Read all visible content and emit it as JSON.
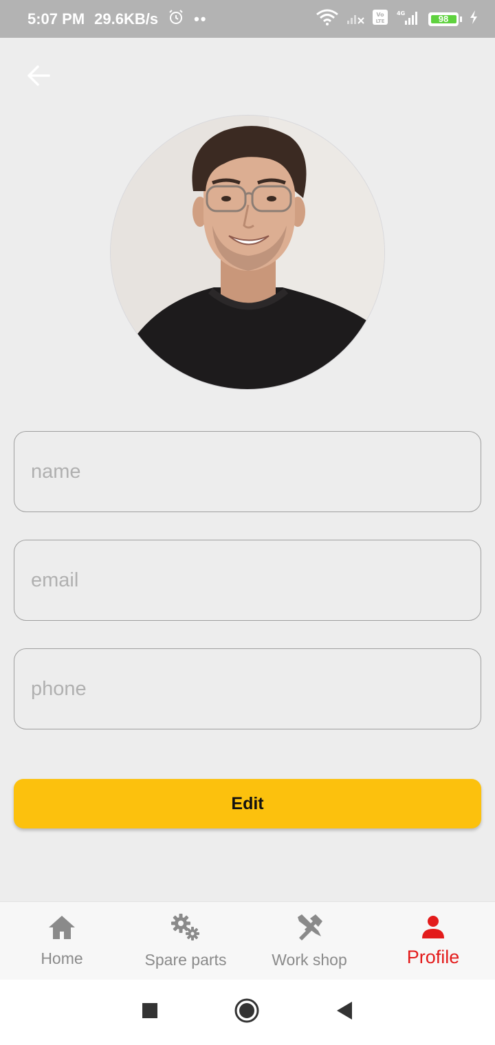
{
  "status_bar": {
    "time": "5:07 PM",
    "net_speed": "29.6KB/s",
    "dots": "••",
    "battery_level": "98",
    "icons": [
      "alarm-icon",
      "wifi-icon",
      "signal-off-icon",
      "volte-icon",
      "signal-4g-icon",
      "battery-icon",
      "charging-icon"
    ]
  },
  "header": {
    "back_icon": "arrow-left-icon"
  },
  "form": {
    "name_placeholder": "name",
    "email_placeholder": "email",
    "phone_placeholder": "phone",
    "name_value": "",
    "email_value": "",
    "phone_value": ""
  },
  "actions": {
    "edit_label": "Edit"
  },
  "bottom_nav": {
    "items": [
      {
        "label": "Home",
        "icon": "home-icon",
        "active": false
      },
      {
        "label": "Spare parts",
        "icon": "gears-icon",
        "active": false
      },
      {
        "label": "Work shop",
        "icon": "tools-icon",
        "active": false
      },
      {
        "label": "Profile",
        "icon": "person-icon",
        "active": true
      }
    ]
  },
  "system_nav": {
    "icons": [
      "recents-icon",
      "home-circle-icon",
      "back-triangle-icon"
    ]
  },
  "colors": {
    "accent": "#fcc10d",
    "active_nav": "#e31b1b",
    "inactive_nav": "#8a8a8a",
    "background": "#ededed"
  }
}
